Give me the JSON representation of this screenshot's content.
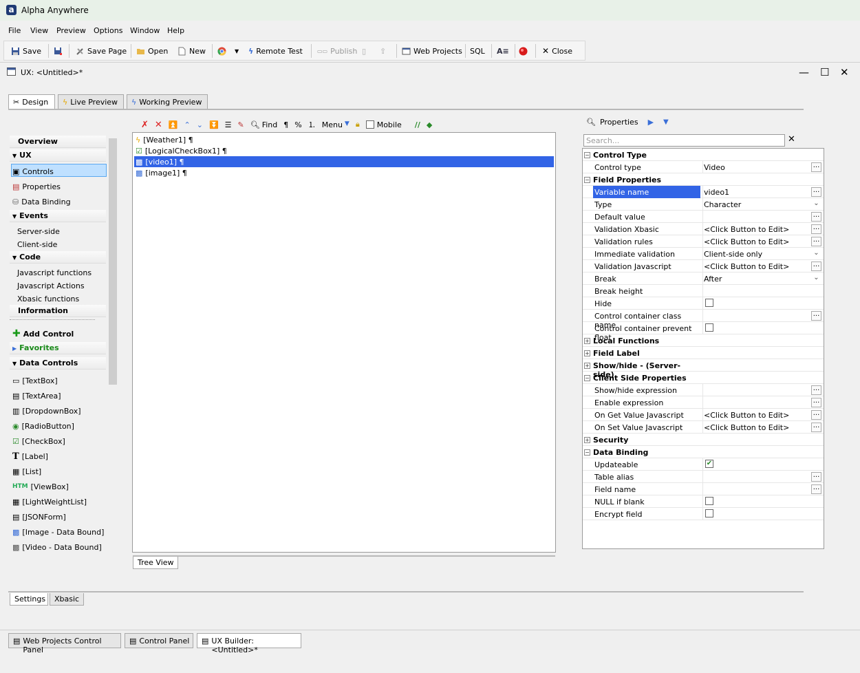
{
  "app": {
    "title": "Alpha Anywhere"
  },
  "menu": {
    "items": [
      "File",
      "View",
      "Preview",
      "Options",
      "Window",
      "Help"
    ]
  },
  "toolbar": {
    "save": "Save",
    "save_page": "Save Page",
    "open": "Open",
    "new": "New",
    "remote_test": "Remote Test",
    "publish": "Publish",
    "web_projects": "Web Projects",
    "sql": "SQL",
    "close": "Close"
  },
  "doc": {
    "title": "UX: <Untitled>*"
  },
  "tabs": {
    "design": "Design",
    "live_preview": "Live Preview",
    "working_preview": "Working Preview"
  },
  "nav": {
    "overview": "Overview",
    "ux": "UX",
    "controls": "Controls",
    "properties": "Properties",
    "data_binding": "Data Binding",
    "events": "Events",
    "server_side": "Server-side",
    "client_side": "Client-side",
    "code": "Code",
    "js_functions": "Javascript functions",
    "js_actions": "Javascript Actions",
    "xbasic_functions": "Xbasic functions",
    "information": "Information",
    "add_control": "Add Control",
    "favorites": "Favorites",
    "data_controls": "Data Controls",
    "controls_list": [
      "[TextBox]",
      "[TextArea]",
      "[DropdownBox]",
      "[RadioButton]",
      "[CheckBox]",
      "[Label]",
      "[List]",
      "[ViewBox]",
      "[LightWeightList]",
      "[JSONForm]",
      "[Image - Data Bound]",
      "[Video - Data Bound]"
    ]
  },
  "middle_toolbar": {
    "find": "Find",
    "pilcrow": "¶",
    "percent": "%",
    "menu": "Menu",
    "mobile": "Mobile"
  },
  "tree": {
    "rows": [
      "[Weather1] ¶",
      "[LogicalCheckBox1] ¶",
      "[video1] ¶",
      "[image1] ¶"
    ],
    "tab": "Tree View"
  },
  "properties": {
    "header": "Properties",
    "search_placeholder": "Search...",
    "rows": [
      {
        "type": "cat",
        "label": "Control Type",
        "exp": "−"
      },
      {
        "label": "Control type",
        "value": "Video",
        "btn": "dots"
      },
      {
        "type": "cat",
        "label": "Field Properties",
        "exp": "−"
      },
      {
        "label": "Variable name",
        "value": "video1",
        "btn": "dots",
        "sel": true
      },
      {
        "label": "Type",
        "value": "Character",
        "btn": "dd"
      },
      {
        "label": "Default value",
        "value": "",
        "btn": "dots"
      },
      {
        "label": "Validation Xbasic",
        "value": "<Click Button to Edit>",
        "btn": "dots"
      },
      {
        "label": "Validation rules",
        "value": "<Click Button to Edit>",
        "btn": "dots"
      },
      {
        "label": "Immediate validation",
        "value": "Client-side only",
        "btn": "dd"
      },
      {
        "label": "Validation Javascript",
        "value": "<Click Button to Edit>",
        "btn": "dots"
      },
      {
        "label": "Break",
        "value": "After",
        "btn": "dd"
      },
      {
        "label": "Break height",
        "value": ""
      },
      {
        "label": "Hide",
        "check": false
      },
      {
        "label": "Control container class name",
        "value": "",
        "btn": "dots"
      },
      {
        "label": "Control container prevent float",
        "check": false
      },
      {
        "type": "cat",
        "label": "Local Functions",
        "exp": "+"
      },
      {
        "type": "cat",
        "label": "Field Label",
        "exp": "+"
      },
      {
        "type": "cat",
        "label": "Show/hide - (Server-side)",
        "exp": "+"
      },
      {
        "type": "cat",
        "label": "Client Side Properties",
        "exp": "−"
      },
      {
        "label": "Show/hide expression",
        "value": "",
        "btn": "dots"
      },
      {
        "label": "Enable expression",
        "value": "",
        "btn": "dots"
      },
      {
        "label": "On Get Value Javascript",
        "value": "<Click Button to Edit>",
        "btn": "dots"
      },
      {
        "label": "On Set Value Javascript",
        "value": "<Click Button to Edit>",
        "btn": "dots"
      },
      {
        "type": "cat",
        "label": "Security",
        "exp": "+"
      },
      {
        "type": "cat",
        "label": "Data Binding",
        "exp": "−"
      },
      {
        "label": "Updateable",
        "check": true
      },
      {
        "label": "Table alias",
        "value": "",
        "btn": "dots"
      },
      {
        "label": "Field name",
        "value": "",
        "btn": "dots"
      },
      {
        "label": "NULL if blank",
        "check": false
      },
      {
        "label": "Encrypt field",
        "check": false
      }
    ]
  },
  "bottom_tabs": {
    "settings": "Settings",
    "xbasic": "Xbasic"
  },
  "taskbar": {
    "items": [
      "Web Projects Control Panel",
      "Control Panel",
      "UX Builder: <Untitled>*"
    ]
  },
  "colors": {
    "selection": "#3264e6",
    "nav_selection": "#bfe0ff",
    "favorites": "#1a8a1a"
  }
}
